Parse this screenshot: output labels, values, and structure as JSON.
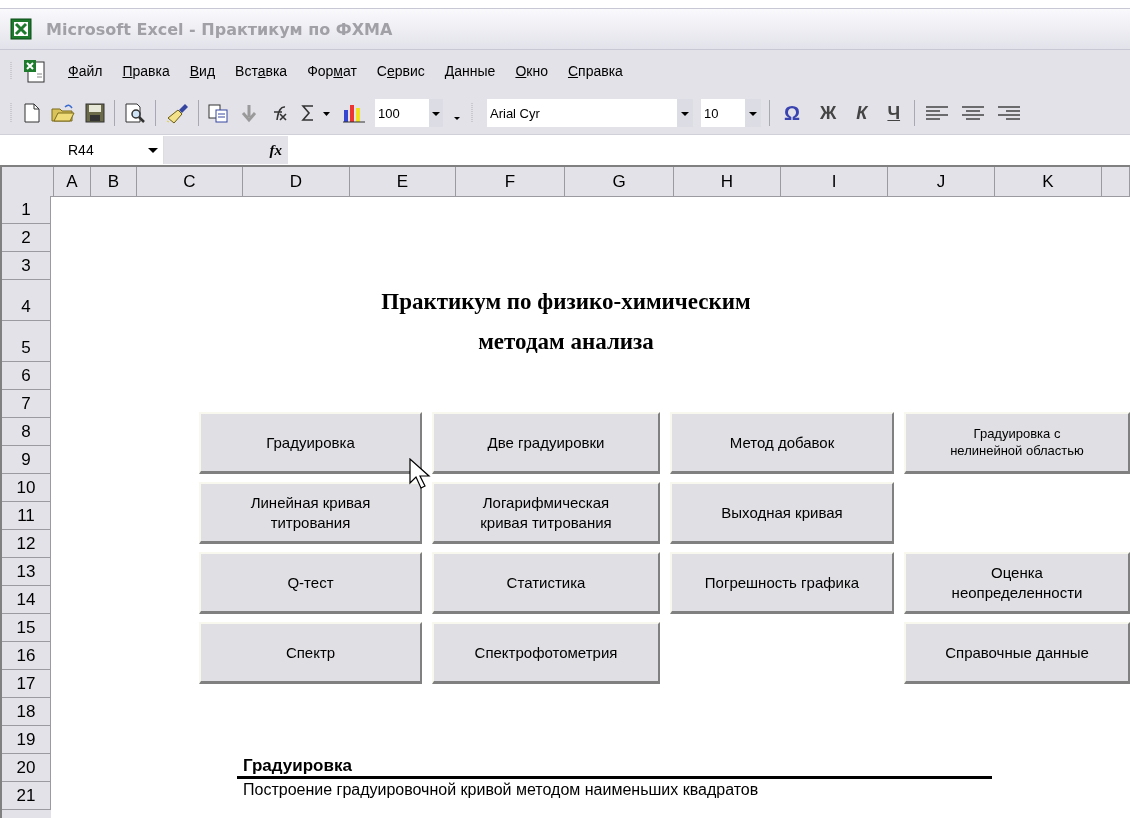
{
  "window": {
    "title": "Microsoft Excel - Практикум по ФХМА"
  },
  "menu": [
    {
      "key": "Ф",
      "after": "айл"
    },
    {
      "key": "П",
      "after": "равка"
    },
    {
      "key": "В",
      "after": "ид"
    },
    {
      "before": "Вст",
      "key": "а",
      "after": "вка"
    },
    {
      "before": "Фор",
      "key": "м",
      "after": "ат"
    },
    {
      "before": "С",
      "key": "е",
      "after": "рвис"
    },
    {
      "key": "Д",
      "after": "анные"
    },
    {
      "key": "О",
      "after": "кно"
    },
    {
      "key": "С",
      "after": "правка"
    }
  ],
  "toolbar": {
    "zoom": "100",
    "font": "Arial Cyr",
    "size": "10",
    "symbol": "Ω",
    "bold": "Ж",
    "italic": "К",
    "underline": "Ч"
  },
  "formula_bar": {
    "name_box": "R44",
    "fx": "fx"
  },
  "columns": [
    "A",
    "B",
    "C",
    "D",
    "E",
    "F",
    "G",
    "H",
    "I",
    "J",
    "K"
  ],
  "rows": [
    "1",
    "2",
    "3",
    "4",
    "5",
    "6",
    "7",
    "8",
    "9",
    "10",
    "11",
    "12",
    "13",
    "14",
    "15",
    "16",
    "17",
    "18",
    "19",
    "20",
    "21"
  ],
  "sheet": {
    "heading": [
      "Практикум по физико-химическим",
      "методам анализа"
    ],
    "button_rows": [
      {
        "cells": [
          {
            "kind": "button",
            "label": "Градуировка",
            "small": false
          },
          {
            "kind": "button",
            "label": "Две градуировки",
            "small": false
          },
          {
            "kind": "button",
            "label": "Метод добавок",
            "small": false
          },
          {
            "kind": "button",
            "label": "Градуировка с\nнелинейной областью",
            "small": true
          }
        ]
      },
      {
        "cells": [
          {
            "kind": "button",
            "label": "Линейная кривая\nтитрования",
            "small": false
          },
          {
            "kind": "button",
            "label": "Логарифмическая\nкривая титрования",
            "small": false
          },
          {
            "kind": "button",
            "label": "Выходная кривая",
            "small": false
          },
          {
            "kind": "blank"
          }
        ]
      },
      {
        "cells": [
          {
            "kind": "button",
            "label": "Q-тест",
            "small": false
          },
          {
            "kind": "button",
            "label": "Статистика",
            "small": false
          },
          {
            "kind": "button",
            "label": "Погрешность графика",
            "small": false
          },
          {
            "kind": "button",
            "label": "Оценка\nнеопределенности",
            "small": false
          }
        ]
      },
      {
        "cells": [
          {
            "kind": "button",
            "label": "Спектр",
            "small": false
          },
          {
            "kind": "button",
            "label": "Спектрофотометрия",
            "small": false
          },
          {
            "kind": "blank"
          },
          {
            "kind": "button",
            "label": "Справочные данные",
            "small": false
          }
        ]
      }
    ],
    "section_title": "Градуировка",
    "section_text": "Построение градуировочной кривой методом наименьших квадратов"
  }
}
